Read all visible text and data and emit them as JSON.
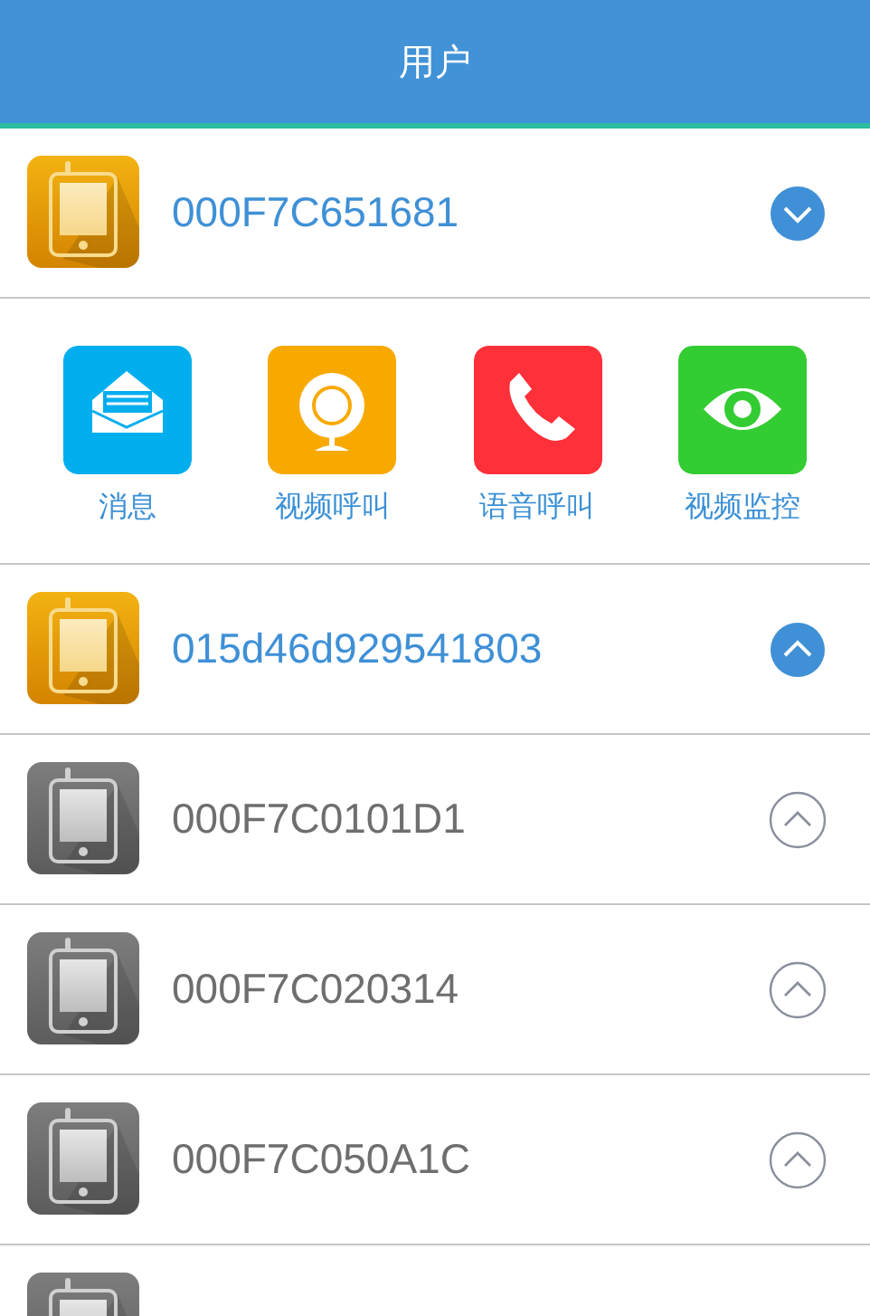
{
  "header": {
    "title": "用户"
  },
  "devices": [
    {
      "id": "000F7C651681",
      "online": true,
      "expanded": true,
      "actions": [
        {
          "kind": "message",
          "label": "消息"
        },
        {
          "kind": "video_call",
          "label": "视频呼叫"
        },
        {
          "kind": "voice_call",
          "label": "语音呼叫"
        },
        {
          "kind": "monitor",
          "label": "视频监控"
        }
      ]
    },
    {
      "id": "015d46d929541803",
      "online": true,
      "expanded": false
    },
    {
      "id": "000F7C0101D1",
      "online": false,
      "expanded": false
    },
    {
      "id": "000F7C020314",
      "online": false,
      "expanded": false
    },
    {
      "id": "000F7C050A1C",
      "online": false,
      "expanded": false
    },
    {
      "online": false
    }
  ]
}
